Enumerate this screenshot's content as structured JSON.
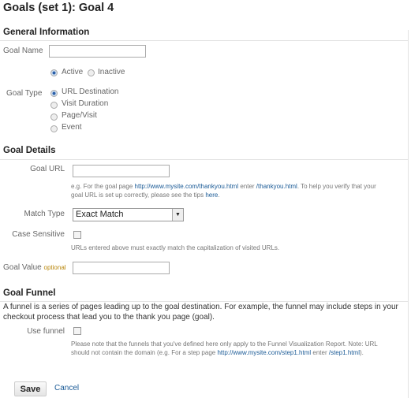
{
  "title": "Goals (set 1): Goal 4",
  "general": {
    "heading": "General Information",
    "goal_name_label": "Goal Name",
    "goal_name_value": "",
    "status_options": [
      "Active",
      "Inactive"
    ],
    "status_selected": "Active",
    "goal_type_label": "Goal Type",
    "goal_type_options": [
      "URL Destination",
      "Visit Duration",
      "Page/Visit",
      "Event"
    ],
    "goal_type_selected": "URL Destination"
  },
  "details": {
    "heading": "Goal Details",
    "goal_url_label": "Goal URL",
    "goal_url_value": "",
    "help1_a": "e.g. For the goal page ",
    "help1_link1": "http://www.mysite.com/thankyou.html",
    "help1_b": " enter ",
    "help1_link2": "/thankyou.html",
    "help1_c": ". To help you verify that your",
    "help2_a": "goal URL is set up correctly, please see the tips ",
    "help2_link": "here",
    "help2_b": ".",
    "match_type_label": "Match Type",
    "match_type_value": "Exact Match",
    "case_label": "Case Sensitive",
    "case_checked": false,
    "case_help": "URLs entered above must exactly match the capitalization of visited URLs.",
    "goal_value_label": "Goal Value",
    "goal_value_optional": "optional",
    "goal_value_value": ""
  },
  "funnel": {
    "heading": "Goal Funnel",
    "desc1": "A funnel is a series of pages leading up to the goal destination. For example, the funnel may include steps in your",
    "desc2": "checkout process that lead you to the thank you page (goal).",
    "use_label": "Use funnel",
    "use_checked": false,
    "note1": "Please note that the funnels that you've defined here only apply to the Funnel Visualization Report. Note: URL",
    "note2_a": "should not contain the domain (e.g. For a step page ",
    "note2_link1": "http://www.mysite.com/step1.html",
    "note2_b": " enter ",
    "note2_link2": "/step1.html",
    "note2_c": ")."
  },
  "actions": {
    "save": "Save",
    "cancel": "Cancel"
  },
  "colors": {
    "link": "#1a5a96",
    "optional": "#b8860b"
  }
}
